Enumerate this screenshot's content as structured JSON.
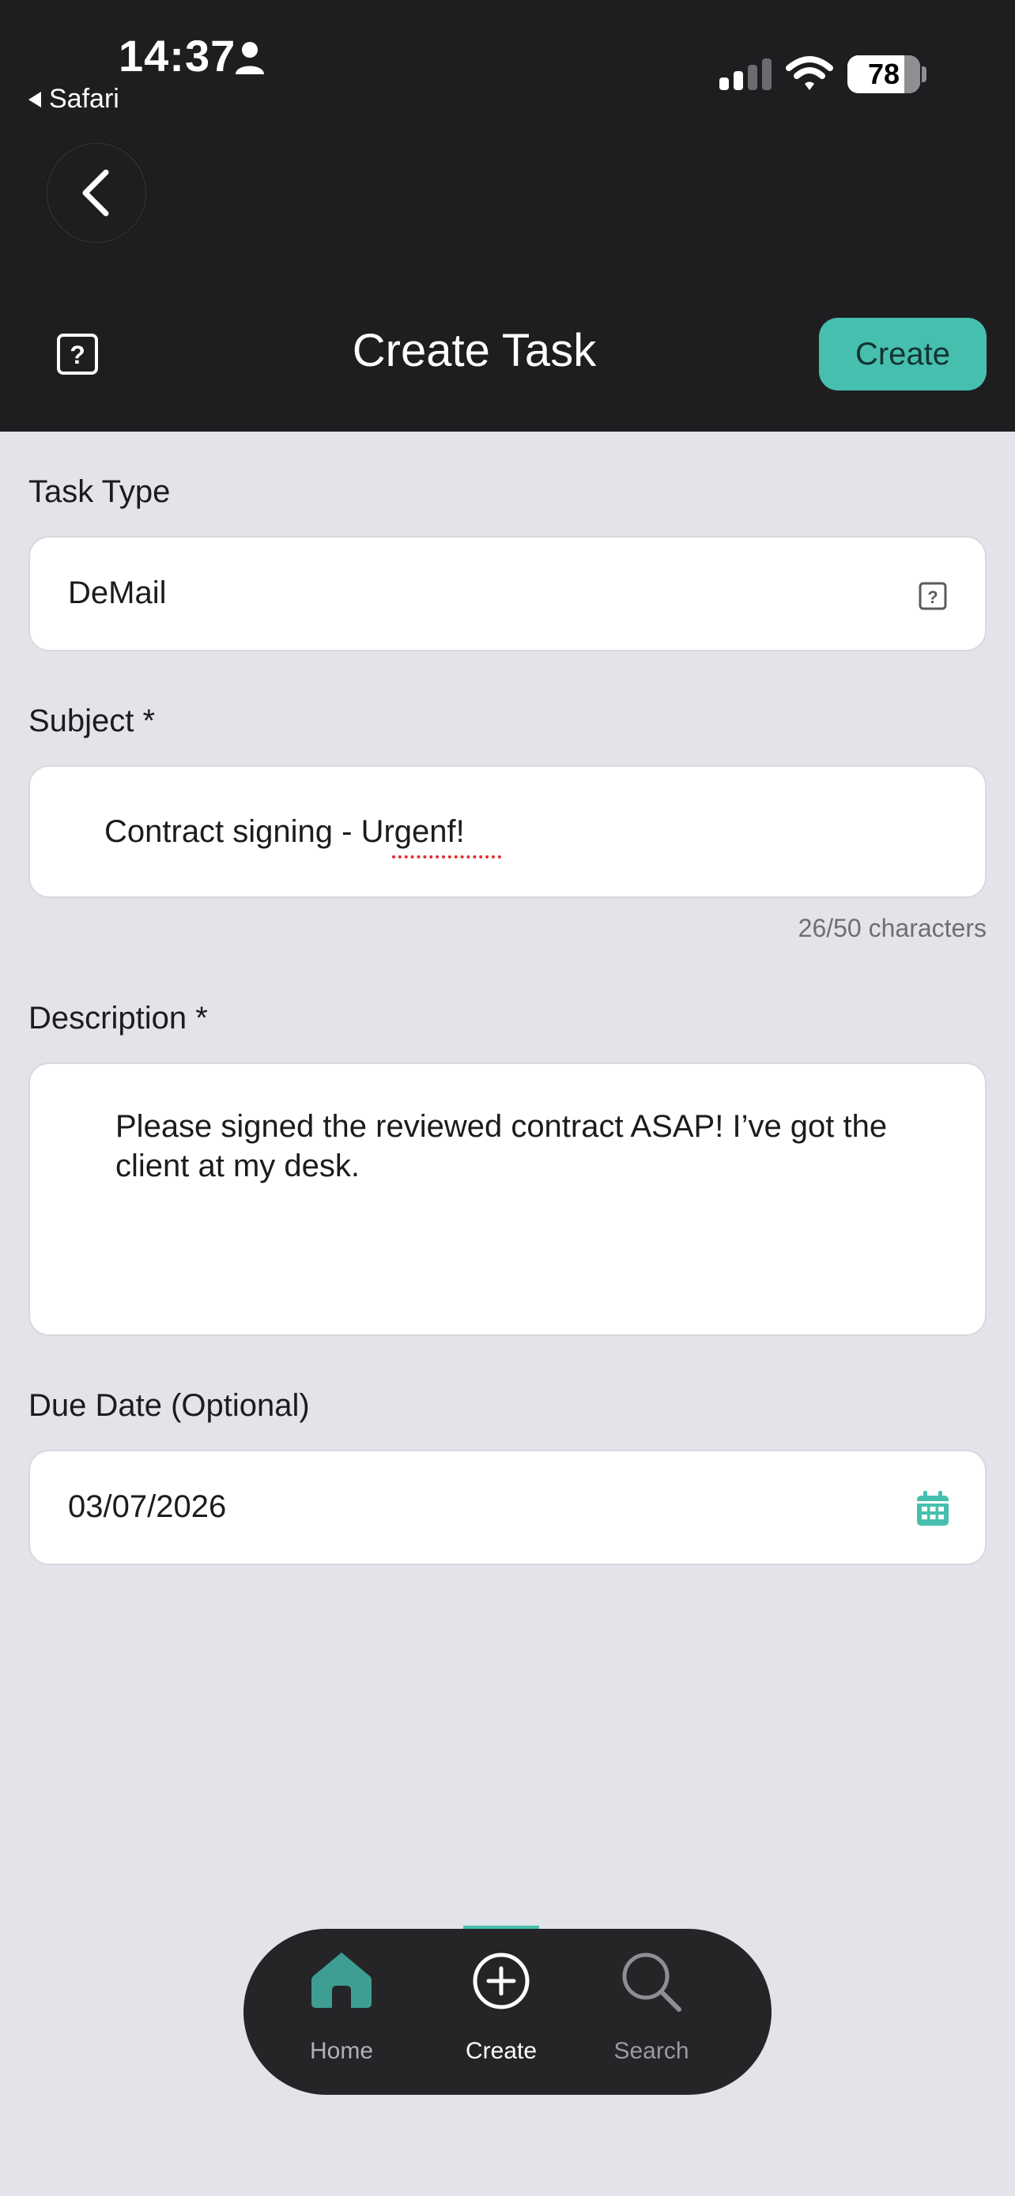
{
  "status_bar": {
    "time": "14:37",
    "back_app": "Safari",
    "battery": "78",
    "battery_level": 0.78
  },
  "header": {
    "title": "Create Task",
    "create_label": "Create"
  },
  "form": {
    "task_type": {
      "label": "Task Type",
      "value": "DeMail"
    },
    "subject": {
      "label": "Subject *",
      "value": "Contract signing - Urgenf!",
      "counter": "26/50 characters"
    },
    "description": {
      "label": "Description *",
      "value": "Please signed the reviewed contract ASAP! I’ve got the client at my desk."
    },
    "due_date": {
      "label": "Due Date (Optional)",
      "value": "03/07/2026"
    }
  },
  "tab_bar": {
    "items": [
      {
        "label": "Home",
        "icon": "home-icon"
      },
      {
        "label": "Create",
        "icon": "plus-circle-icon",
        "active": true
      },
      {
        "label": "Search",
        "icon": "search-icon"
      }
    ]
  },
  "colors": {
    "accent": "#46bfae",
    "header_bg": "#1e1e20",
    "page_bg": "#e3e3ea"
  }
}
